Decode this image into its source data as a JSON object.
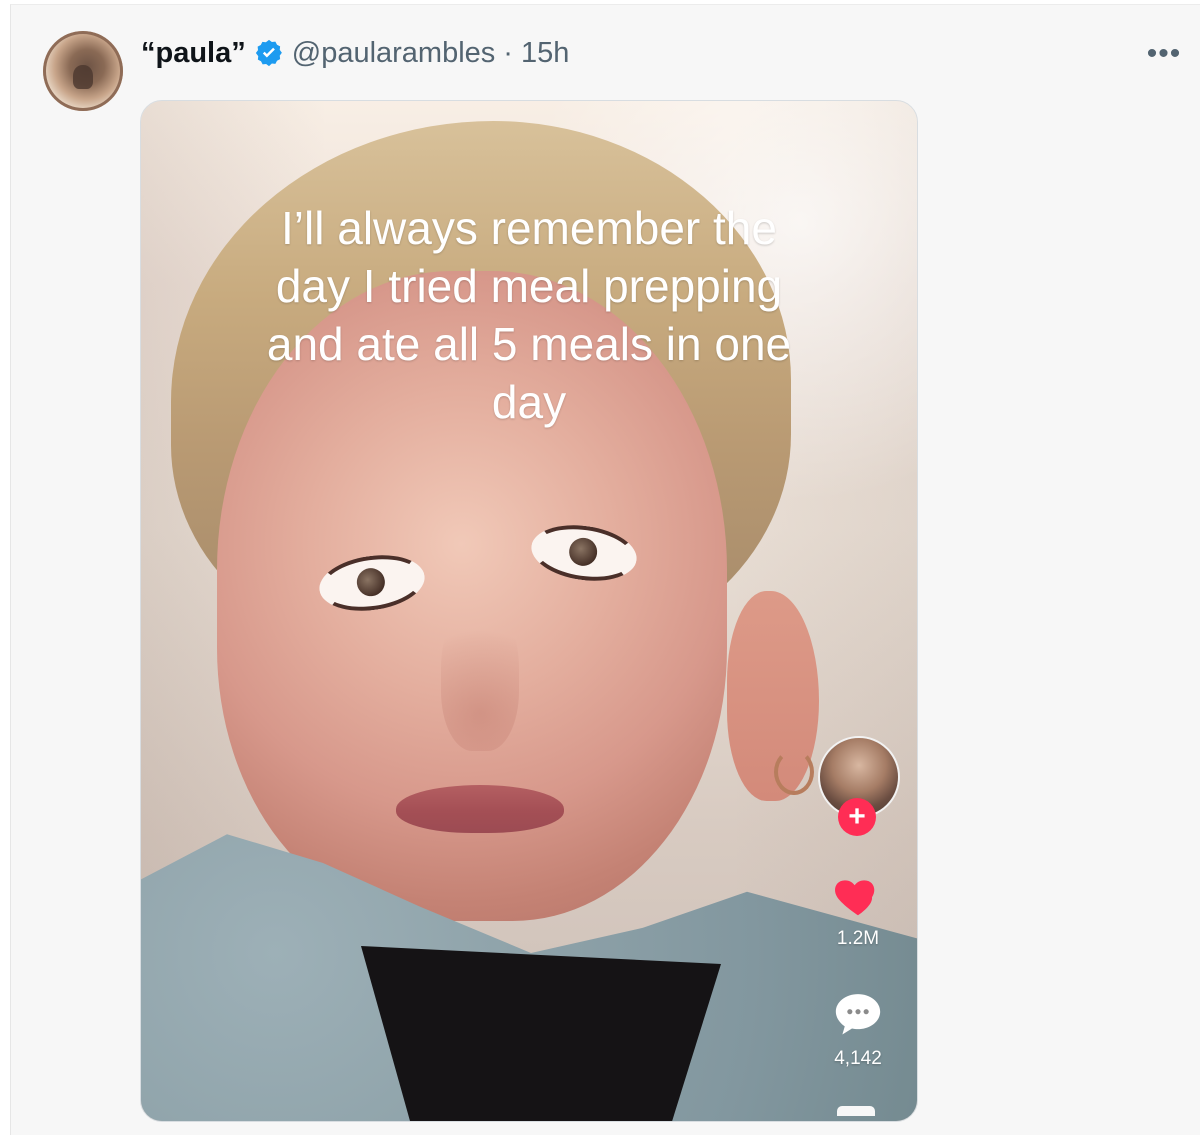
{
  "post": {
    "display_name": "“paula”",
    "handle": "@paularambles",
    "separator": "·",
    "time": "15h",
    "more_label": "•••"
  },
  "media": {
    "caption": "I’ll always remember the day I tried meal prepping and ate all 5 meals in one day",
    "follow_label": "+",
    "likes": "1.2M",
    "comments": "4,142"
  },
  "icons": {
    "verified": "verified-icon",
    "heart": "heart-icon",
    "comment": "comment-icon",
    "more": "more-icon"
  },
  "colors": {
    "verified_blue": "#1d9bf0",
    "accent_pink": "#ff2d55",
    "text_primary": "#0f1419",
    "text_secondary": "#536471"
  }
}
